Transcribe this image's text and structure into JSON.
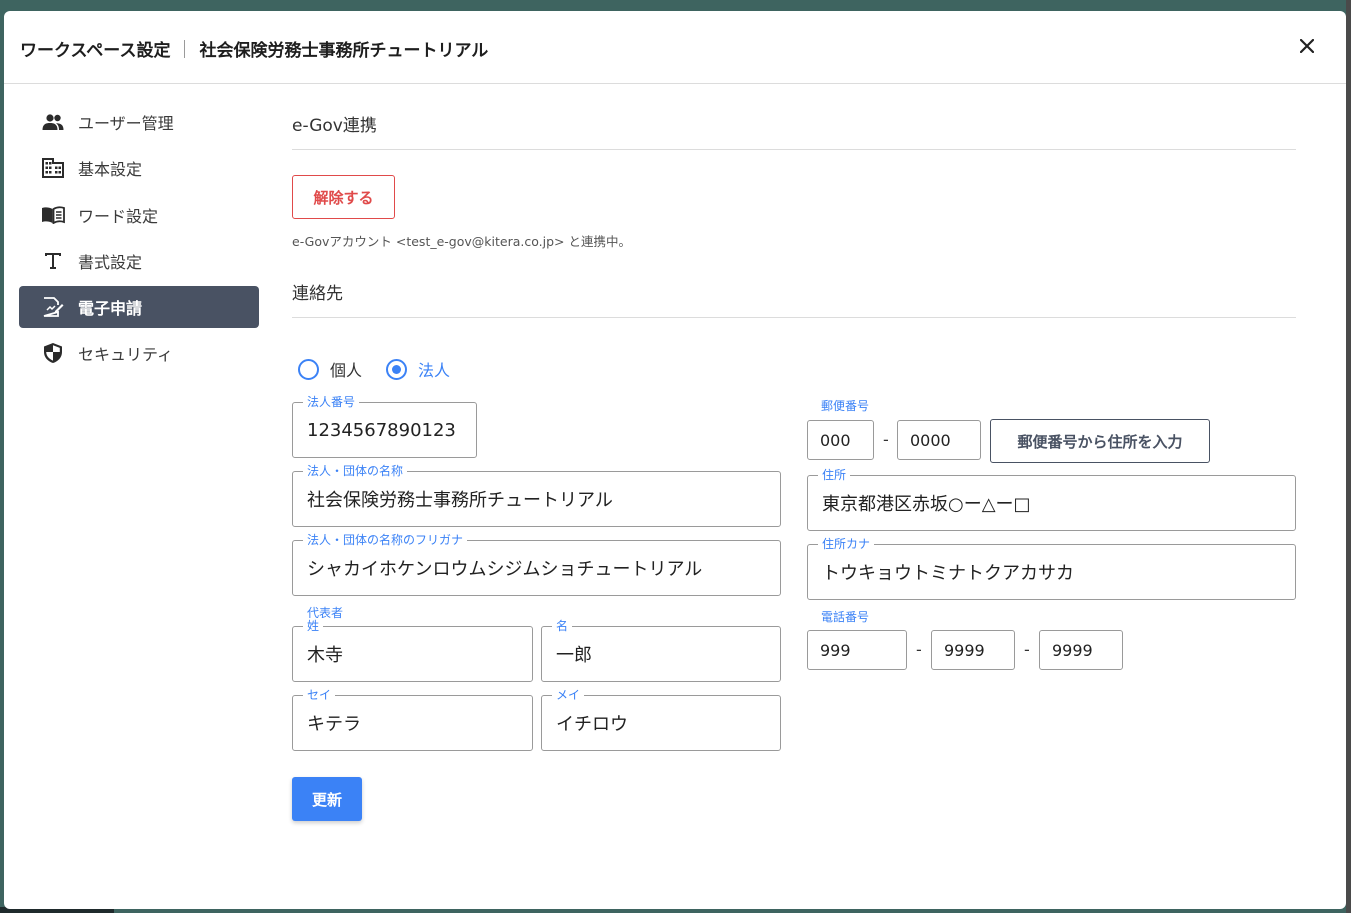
{
  "colors": {
    "primary": "#3b82f6",
    "danger": "#e04a4a",
    "sidebar_active_bg": "#495263",
    "backdrop": "#3e6460"
  },
  "header": {
    "title": "ワークスペース設定",
    "workspace_name": "社会保険労務士事務所チュートリアル",
    "close_icon": "close-icon"
  },
  "sidebar": {
    "items": [
      {
        "label": "ユーザー管理",
        "icon": "users-icon",
        "active": false
      },
      {
        "label": "基本設定",
        "icon": "building-icon",
        "active": false
      },
      {
        "label": "ワード設定",
        "icon": "book-icon",
        "active": false
      },
      {
        "label": "書式設定",
        "icon": "text-format-icon",
        "active": false
      },
      {
        "label": "電子申請",
        "icon": "document-edit-icon",
        "active": true
      },
      {
        "label": "セキュリティ",
        "icon": "shield-icon",
        "active": false
      }
    ]
  },
  "egov": {
    "section_title": "e-Gov連携",
    "unlink_button": "解除する",
    "note": "e-Govアカウント <test_e-gov@kitera.co.jp> と連携中。"
  },
  "contact": {
    "section_title": "連絡先",
    "radio_options": [
      {
        "label": "個人",
        "checked": false
      },
      {
        "label": "法人",
        "checked": true
      }
    ],
    "corp_number": {
      "label": "法人番号",
      "value": "1234567890123"
    },
    "org_name": {
      "label": "法人・団体の名称",
      "value": "社会保険労務士事務所チュートリアル"
    },
    "org_name_kana": {
      "label": "法人・団体の名称のフリガナ",
      "value": "シャカイホケンロウムシジムショチュートリアル"
    },
    "representative_label": "代表者",
    "last_name": {
      "label": "姓",
      "value": "木寺"
    },
    "first_name": {
      "label": "名",
      "value": "一郎"
    },
    "last_name_kana": {
      "label": "セイ",
      "value": "キテラ"
    },
    "first_name_kana": {
      "label": "メイ",
      "value": "イチロウ"
    },
    "postal": {
      "label": "郵便番号",
      "part1": "000",
      "part2": "0000",
      "separator": "-",
      "lookup_button": "郵便番号から住所を入力"
    },
    "address": {
      "label": "住所",
      "value": "東京都港区赤坂○ー△ー□"
    },
    "address_kana": {
      "label": "住所カナ",
      "value": "トウキョウトミナトクアカサカ"
    },
    "phone": {
      "label": "電話番号",
      "part1": "999",
      "part2": "9999",
      "part3": "9999",
      "separator": "-"
    },
    "update_button": "更新"
  }
}
